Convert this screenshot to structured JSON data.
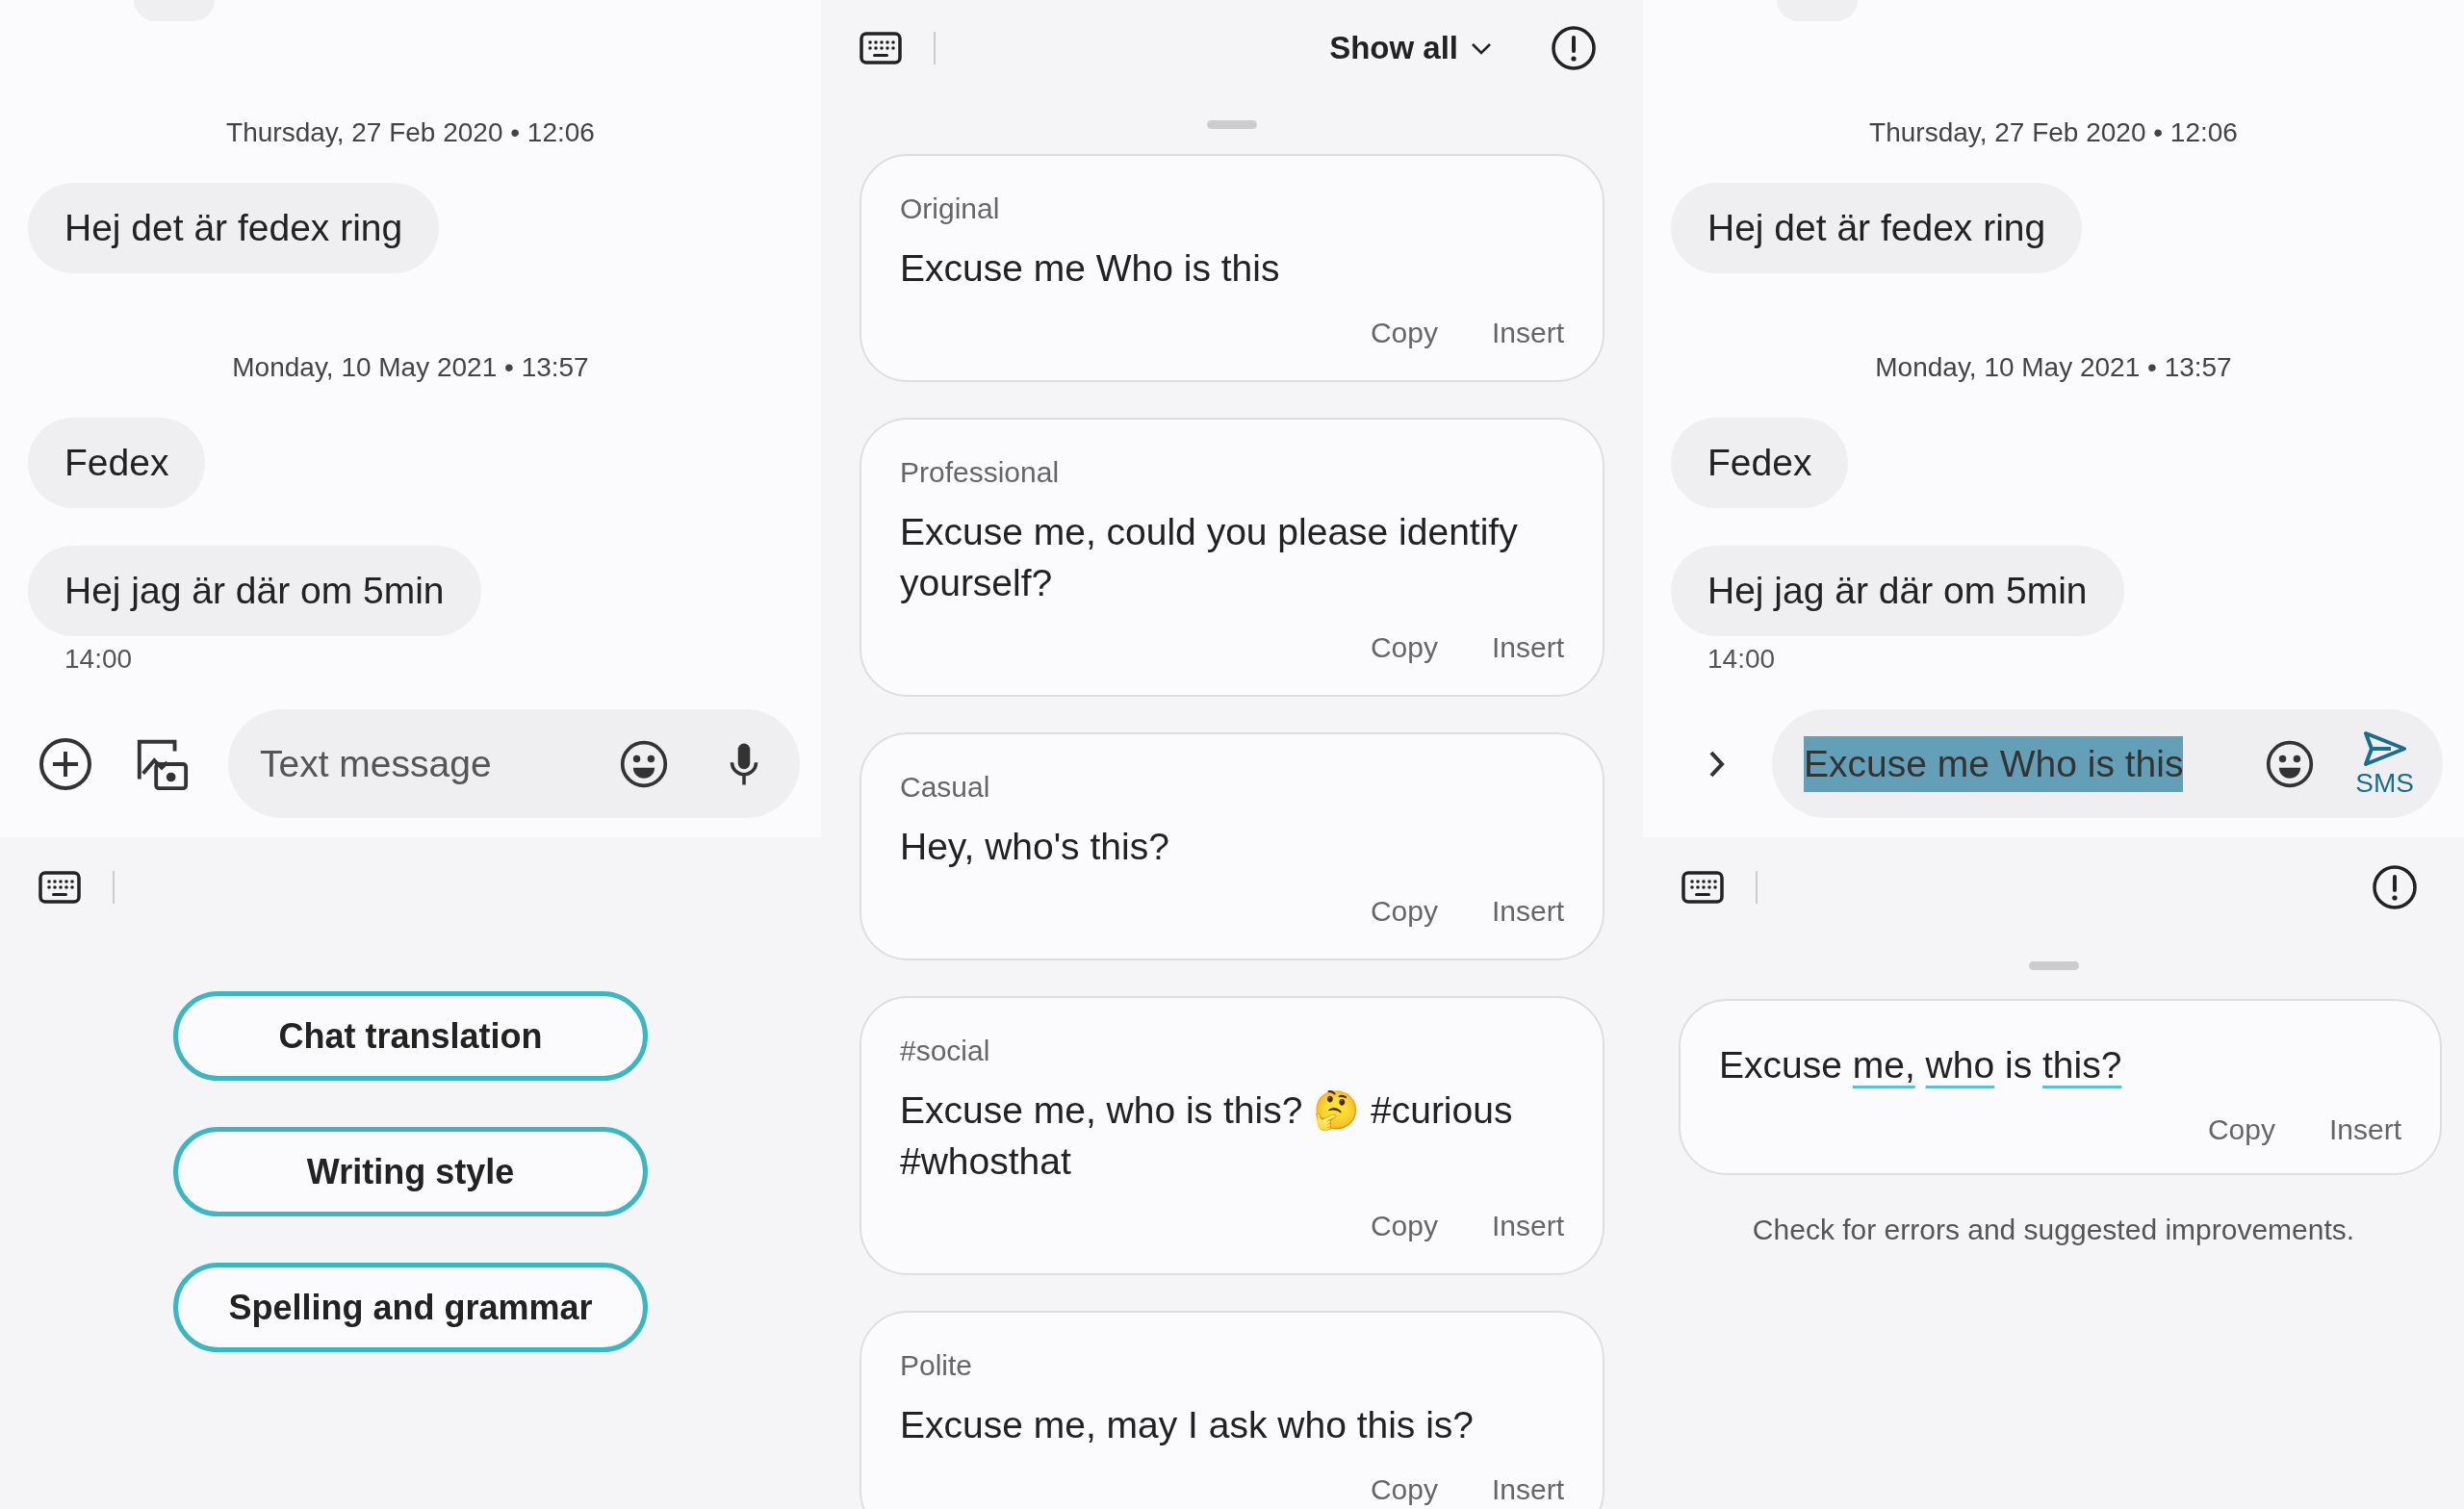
{
  "left_screen": {
    "conversation": [
      {
        "kind": "date",
        "text": "Thursday, 27 Feb 2020 • 12:06"
      },
      {
        "kind": "bubble",
        "text": "Hej det är fedex ring"
      },
      {
        "kind": "date",
        "text": "Monday, 10 May 2021 • 13:57"
      },
      {
        "kind": "bubble",
        "text": "Fedex"
      },
      {
        "kind": "bubble",
        "text": "Hej jag är där om 5min",
        "time": "14:00"
      }
    ],
    "composer": {
      "placeholder": "Text message"
    },
    "assist_menu": {
      "options": [
        "Chat translation",
        "Writing style",
        "Spelling and grammar"
      ]
    }
  },
  "middle_screen": {
    "toolbar": {
      "show_all": "Show all"
    },
    "suggestions": [
      {
        "label": "Original",
        "text": "Excuse me Who is this",
        "actions": [
          "Copy",
          "Insert"
        ]
      },
      {
        "label": "Professional",
        "text": "Excuse me, could you please identify yourself?",
        "actions": [
          "Copy",
          "Insert"
        ]
      },
      {
        "label": "Casual",
        "text": "Hey, who's this?",
        "actions": [
          "Copy",
          "Insert"
        ]
      },
      {
        "label": "#social",
        "text": "Excuse me, who is this? 🤔 #curious #whosthat",
        "actions": [
          "Copy",
          "Insert"
        ]
      },
      {
        "label": "Polite",
        "text": "Excuse me, may I ask who this is?",
        "actions": [
          "Copy",
          "Insert"
        ]
      }
    ]
  },
  "right_screen": {
    "conversation": [
      {
        "kind": "date",
        "text": "Thursday, 27 Feb 2020 • 12:06"
      },
      {
        "kind": "bubble",
        "text": "Hej det är fedex ring"
      },
      {
        "kind": "date",
        "text": "Monday, 10 May 2021 • 13:57"
      },
      {
        "kind": "bubble",
        "text": "Fedex"
      },
      {
        "kind": "bubble",
        "text": "Hej jag är där om 5min",
        "time": "14:00"
      }
    ],
    "composer": {
      "value": "Excuse me Who is this",
      "selected": true,
      "send_label": "SMS"
    },
    "suggestion": {
      "segments": [
        {
          "text": "Excuse",
          "changed": false
        },
        {
          "text": "me,",
          "changed": true
        },
        {
          "text": "who",
          "changed": true
        },
        {
          "text": "is",
          "changed": false
        },
        {
          "text": "this?",
          "changed": true
        }
      ],
      "actions": [
        "Copy",
        "Insert"
      ]
    },
    "caption": "Check for errors and suggested improvements."
  }
}
